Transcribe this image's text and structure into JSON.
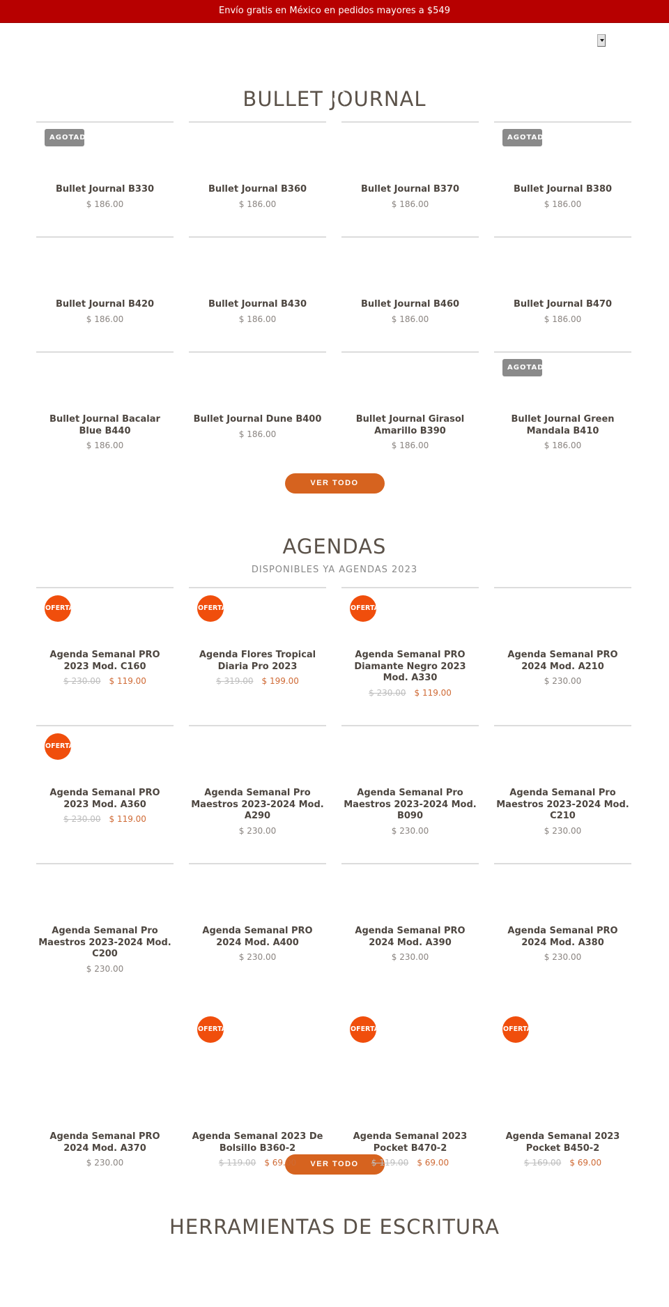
{
  "announcement": "Envío gratis en México en pedidos mayores a $549",
  "header": {
    "language_selector_icon": "dropdown-arrow-icon"
  },
  "sections": {
    "bullet_journal": {
      "title": "BULLET JOURNAL",
      "view_all_label": "VER TODO",
      "products": [
        {
          "name": "Bullet Journal B330",
          "price": "$ 186.00",
          "badge": "AGOTADO"
        },
        {
          "name": "Bullet Journal B360",
          "price": "$ 186.00",
          "badge": ""
        },
        {
          "name": "Bullet Journal B370",
          "price": "$ 186.00",
          "badge": ""
        },
        {
          "name": "Bullet Journal B380",
          "price": "$ 186.00",
          "badge": "AGOTADO"
        },
        {
          "name": "Bullet Journal B420",
          "price": "$ 186.00",
          "badge": ""
        },
        {
          "name": "Bullet Journal B430",
          "price": "$ 186.00",
          "badge": ""
        },
        {
          "name": "Bullet Journal B460",
          "price": "$ 186.00",
          "badge": ""
        },
        {
          "name": "Bullet Journal B470",
          "price": "$ 186.00",
          "badge": ""
        },
        {
          "name": "Bullet Journal Bacalar Blue B440",
          "price": "$ 186.00",
          "badge": ""
        },
        {
          "name": "Bullet Journal Dune B400",
          "price": "$ 186.00",
          "badge": ""
        },
        {
          "name": "Bullet Journal Girasol Amarillo B390",
          "price": "$ 186.00",
          "badge": ""
        },
        {
          "name": "Bullet Journal Green Mandala B410",
          "price": "$ 186.00",
          "badge": "AGOTADO"
        }
      ]
    },
    "agendas": {
      "title": "AGENDAS",
      "subtitle": "DISPONIBLES YA AGENDAS 2023",
      "view_all_label": "VER TODO",
      "products": [
        {
          "name": "Agenda Semanal PRO 2023 Mod. C160",
          "old_price": "$ 230.00",
          "price": "$ 119.00",
          "badge": "OFERTA"
        },
        {
          "name": "Agenda Flores Tropical Diaria Pro 2023",
          "old_price": "$ 319.00",
          "price": "$ 199.00",
          "badge": "OFERTA"
        },
        {
          "name": "Agenda Semanal PRO Diamante Negro 2023 Mod. A330",
          "old_price": "$ 230.00",
          "price": "$ 119.00",
          "badge": "OFERTA"
        },
        {
          "name": "Agenda Semanal PRO 2024 Mod. A210",
          "old_price": "",
          "price": "$ 230.00",
          "badge": ""
        },
        {
          "name": "Agenda Semanal PRO 2023 Mod. A360",
          "old_price": "$ 230.00",
          "price": "$ 119.00",
          "badge": "OFERTA"
        },
        {
          "name": "Agenda Semanal Pro Maestros 2023-2024 Mod. A290",
          "old_price": "",
          "price": "$ 230.00",
          "badge": ""
        },
        {
          "name": "Agenda Semanal Pro Maestros 2023-2024 Mod. B090",
          "old_price": "",
          "price": "$ 230.00",
          "badge": ""
        },
        {
          "name": "Agenda Semanal Pro Maestros 2023-2024 Mod. C210",
          "old_price": "",
          "price": "$ 230.00",
          "badge": ""
        },
        {
          "name": "Agenda Semanal Pro Maestros 2023-2024 Mod. C200",
          "old_price": "",
          "price": "$ 230.00",
          "badge": ""
        },
        {
          "name": "Agenda Semanal PRO 2024 Mod. A400",
          "old_price": "",
          "price": "$ 230.00",
          "badge": ""
        },
        {
          "name": "Agenda Semanal PRO 2024 Mod. A390",
          "old_price": "",
          "price": "$ 230.00",
          "badge": ""
        },
        {
          "name": "Agenda Semanal PRO 2024 Mod. A380",
          "old_price": "",
          "price": "$ 230.00",
          "badge": ""
        },
        {
          "name": "Agenda Semanal PRO 2024 Mod. A370",
          "old_price": "",
          "price": "$ 230.00",
          "badge": ""
        },
        {
          "name": "Agenda Semanal 2023 De Bolsillo B360-2",
          "old_price": "$ 119.00",
          "price": "$ 69.00",
          "badge": "OFERTA"
        },
        {
          "name": "Agenda Semanal 2023 Pocket B470-2",
          "old_price": "$ 119.00",
          "price": "$ 69.00",
          "badge": "OFERTA"
        },
        {
          "name": "Agenda Semanal 2023 Pocket B450-2",
          "old_price": "$ 169.00",
          "price": "$ 69.00",
          "badge": "OFERTA"
        }
      ]
    },
    "tools": {
      "title": "HERRAMIENTAS DE ESCRITURA"
    }
  },
  "colors": {
    "announcement_bg": "#b70000",
    "button_bg": "#d6631f",
    "sale_badge": "#f04e0c",
    "sold_out_badge": "#8a8a8a",
    "sale_price": "#cf6a35"
  }
}
